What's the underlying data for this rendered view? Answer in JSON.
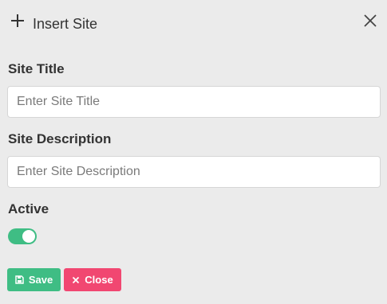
{
  "dialog": {
    "title": "Insert Site",
    "header_icon": "plus-icon",
    "close_icon": "close-x-icon"
  },
  "form": {
    "title_label": "Site Title",
    "title_placeholder": "Enter Site Title",
    "title_value": "",
    "description_label": "Site Description",
    "description_placeholder": "Enter Site Description",
    "description_value": "",
    "active_label": "Active",
    "active": true
  },
  "buttons": {
    "save_label": "Save",
    "save_icon": "save-icon",
    "close_label": "Close",
    "close_icon": "close-icon"
  },
  "colors": {
    "background": "#ebebeb",
    "success": "#3fbd84",
    "danger": "#f14771"
  }
}
